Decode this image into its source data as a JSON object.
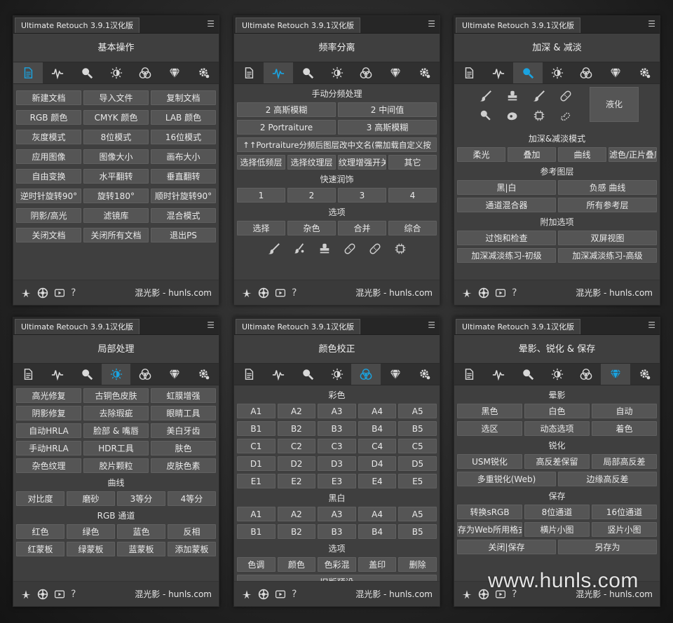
{
  "panel_tab_label": "Ultimate Retouch 3.9.1汉化版",
  "footer_brand": "混光影 - hunls.com",
  "watermark": "www.hunls.com",
  "accent_color": "#1aa3e0",
  "icons": [
    "document-icon",
    "waveform-icon",
    "magnifier-icon",
    "sun-icon",
    "rgb-circles-icon",
    "diamond-icon",
    "gear-icon"
  ],
  "panels": [
    {
      "title": "基本操作",
      "rows": [
        [
          "新建文档",
          "导入文件",
          "复制文档"
        ],
        [
          "RGB 颜色",
          "CMYK 颜色",
          "LAB 颜色"
        ],
        [
          "灰度模式",
          "8位模式",
          "16位模式"
        ],
        [
          "应用图像",
          "图像大小",
          "画布大小"
        ],
        [
          "自由变换",
          "水平翻转",
          "垂直翻转"
        ],
        [
          "逆时针旋转90°",
          "旋转180°",
          "顺时针旋转90°"
        ],
        [
          "阴影/高光",
          "滤镜库",
          "混合模式"
        ],
        [
          "关闭文档",
          "关闭所有文档",
          "退出PS"
        ]
      ]
    },
    {
      "title": "频率分离",
      "section_manual": "手动分频处理",
      "rows_a": [
        [
          "2 高斯模糊",
          "2 中间值"
        ],
        [
          "2 Portraiture",
          "3 高斯模糊"
        ]
      ],
      "long_button": "↑↑Portraiture分频后图层改中文名(需加载自定义按",
      "rows_b": [
        [
          "选择低频层",
          "选择纹理层",
          "纹理增强开关",
          "其它"
        ]
      ],
      "section_quick": "快速润饰",
      "rows_c": [
        [
          "1",
          "2",
          "3",
          "4"
        ]
      ],
      "section_options": "选项",
      "rows_d": [
        [
          "选择",
          "杂色",
          "合并",
          "综合"
        ]
      ]
    },
    {
      "title": "加深 & 减淡",
      "liquify": "液化",
      "section_mode": "加深&减淡模式",
      "rows_a": [
        [
          "柔光",
          "叠加",
          "曲线",
          "滤色/正片叠底"
        ]
      ],
      "section_ref": "参考图层",
      "rows_b": [
        [
          "黑|白",
          "负感 曲线"
        ],
        [
          "通道混合器",
          "所有参考层"
        ]
      ],
      "section_extra": "附加选项",
      "rows_c": [
        [
          "过饱和检查",
          "双屏视图"
        ],
        [
          "加深减淡练习-初级",
          "加深减淡练习-高级"
        ]
      ]
    },
    {
      "title": "局部处理",
      "rows_a": [
        [
          "高光修复",
          "古铜色皮肤",
          "虹膜增强"
        ],
        [
          "阴影修复",
          "去除瑕疵",
          "眼睛工具"
        ],
        [
          "自动HRLA",
          "脸部 & 嘴唇",
          "美白牙齿"
        ],
        [
          "手动HRLA",
          "HDR工具",
          "肤色"
        ],
        [
          "杂色纹理",
          "胶片颗粒",
          "皮肤色素"
        ]
      ],
      "section_curve": "曲线",
      "rows_b": [
        [
          "对比度",
          "磨砂",
          "3等分",
          "4等分"
        ]
      ],
      "section_rgb": "RGB 通道",
      "rows_c": [
        [
          "红色",
          "绿色",
          "蓝色",
          "反相"
        ],
        [
          "红蒙板",
          "绿蒙板",
          "蓝蒙板",
          "添加蒙板"
        ]
      ]
    },
    {
      "title": "颜色校正",
      "section_color": "彩色",
      "rows_a": [
        [
          "A1",
          "A2",
          "A3",
          "A4",
          "A5"
        ],
        [
          "B1",
          "B2",
          "B3",
          "B4",
          "B5"
        ],
        [
          "C1",
          "C2",
          "C3",
          "C4",
          "C5"
        ],
        [
          "D1",
          "D2",
          "D3",
          "D4",
          "D5"
        ],
        [
          "E1",
          "E2",
          "E3",
          "E4",
          "E5"
        ]
      ],
      "section_bw": "黑白",
      "rows_b": [
        [
          "A1",
          "A2",
          "A3",
          "A4",
          "A5"
        ],
        [
          "B1",
          "B2",
          "B3",
          "B4",
          "B5"
        ]
      ],
      "section_options": "选项",
      "rows_c": [
        [
          "色调",
          "颜色",
          "色彩混",
          "盖印",
          "删除"
        ]
      ],
      "wide_button": "旧版预设"
    },
    {
      "title": "晕影、锐化 & 保存",
      "section_vignette": "晕影",
      "rows_a": [
        [
          "黑色",
          "白色",
          "自动"
        ],
        [
          "选区",
          "动态选项",
          "着色"
        ]
      ],
      "section_sharpen": "锐化",
      "rows_b": [
        [
          "USM锐化",
          "高反差保留",
          "局部高反差"
        ],
        [
          "多重锐化(Web)",
          "边缘高反差"
        ]
      ],
      "section_save": "保存",
      "rows_c": [
        [
          "转换sRGB",
          "8位通道",
          "16位通道"
        ],
        [
          "存为Web所用格式",
          "横片小图",
          "竖片小图"
        ],
        [
          "关闭|保存",
          "另存为"
        ]
      ]
    }
  ]
}
